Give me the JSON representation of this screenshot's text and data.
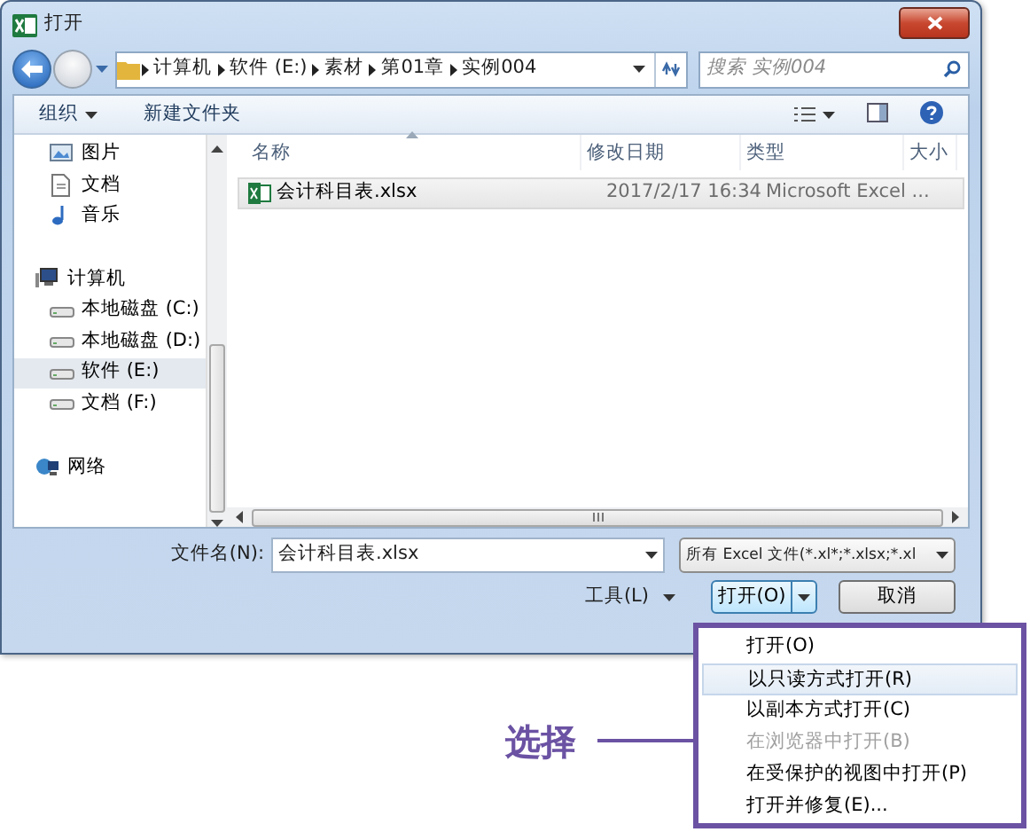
{
  "window": {
    "title": "打开"
  },
  "address": {
    "path": [
      "计算机",
      "软件 (E:)",
      "素材",
      "第01章",
      "实例004"
    ],
    "search_placeholder": "搜索 实例004"
  },
  "toolbar": {
    "buttons": [
      {
        "label": "组织",
        "kind": "menu"
      },
      {
        "label": "新建文件夹",
        "kind": "plain"
      }
    ]
  },
  "sidebar": {
    "library_items": [
      {
        "label": "图片",
        "kind": "picture",
        "selected": false
      },
      {
        "label": "文档",
        "kind": "document",
        "selected": false
      },
      {
        "label": "音乐",
        "kind": "music",
        "selected": false
      }
    ],
    "tree": [
      {
        "label": "计算机",
        "kind": "computer",
        "selected": false,
        "children": [
          {
            "label": "本地磁盘 (C:)",
            "kind": "drive",
            "selected": false
          },
          {
            "label": "本地磁盘 (D:)",
            "kind": "drive",
            "selected": false
          },
          {
            "label": "软件 (E:)",
            "kind": "drive",
            "selected": true
          },
          {
            "label": "文档 (F:)",
            "kind": "drive",
            "selected": false
          }
        ]
      },
      {
        "label": "网络",
        "kind": "network",
        "selected": false
      }
    ]
  },
  "table": {
    "columns": [
      "名称",
      "修改日期",
      "类型",
      "大小"
    ],
    "rows": [
      {
        "name": "会计科目表.xlsx",
        "modified": "2017/2/17 16:34",
        "type": "Microsoft Excel ...",
        "selected": true
      }
    ]
  },
  "bottom": {
    "filename_label": "文件名(N):",
    "filename": "会计科目表.xlsx",
    "filter": "所有 Excel 文件(*.xl*;*.xlsx;*.xl",
    "tools": "工具(L)",
    "open": "打开(O)",
    "cancel": "取消"
  },
  "open_menu": {
    "items": [
      {
        "label": "打开(O)",
        "disabled": false,
        "selected": false
      },
      {
        "label": "以只读方式打开(R)",
        "disabled": false,
        "selected": true
      },
      {
        "label": "以副本方式打开(C)",
        "disabled": false,
        "selected": false
      },
      {
        "label": "在浏览器中打开(B)",
        "disabled": true,
        "selected": false
      },
      {
        "label": "在受保护的视图中打开(P)",
        "disabled": false,
        "selected": false
      },
      {
        "label": "打开并修复(E)...",
        "disabled": false,
        "selected": false
      }
    ]
  },
  "callout": {
    "label": "选择"
  }
}
